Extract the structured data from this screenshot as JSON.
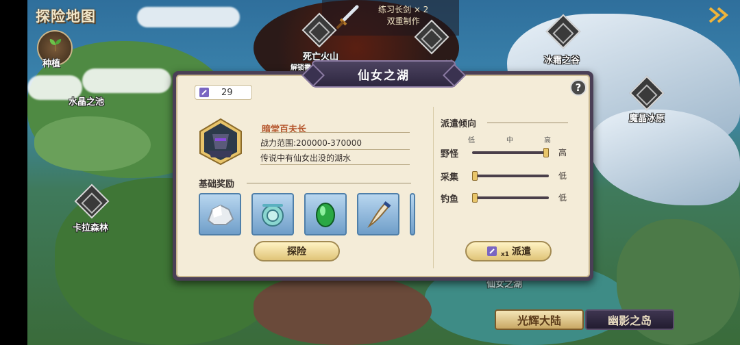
{
  "map": {
    "title": "探险地图",
    "plant_label": "种植",
    "locations": [
      {
        "name": "死亡火山"
      },
      {
        "name": "水晶之池"
      },
      {
        "name": "冰霜之谷"
      },
      {
        "name": "魔晶冰原"
      },
      {
        "name": "卡拉森林"
      }
    ],
    "obscured_labels": [
      "解锁需",
      "池",
      "仙女之湖"
    ],
    "quest": {
      "line1": "练习长剑 × 2",
      "line2": "双重制作"
    },
    "region_tabs": [
      {
        "label": "光辉大陆",
        "active": true
      },
      {
        "label": "幽影之岛",
        "active": false
      }
    ]
  },
  "dialog": {
    "title": "仙女之湖",
    "help_label": "?",
    "ticket_count": "29",
    "boss": {
      "name": "暗堂百夫长",
      "power_range": "战力范围:200000-370000",
      "description": "传说中有仙女出没的湖水"
    },
    "rewards_heading": "基础奖励",
    "rewards": [
      {
        "icon": "silver-ore-icon"
      },
      {
        "icon": "sea-scroll-icon"
      },
      {
        "icon": "emerald-gem-icon"
      },
      {
        "icon": "horn-tooth-icon"
      }
    ],
    "explore_button": "探险",
    "dispatch": {
      "heading": "派遣倾向",
      "levels": [
        "低",
        "中",
        "高"
      ],
      "sliders": [
        {
          "label": "野怪",
          "value_text": "高",
          "level": 1.0
        },
        {
          "label": "采集",
          "value_text": "低",
          "level": 0.0
        },
        {
          "label": "钓鱼",
          "value_text": "低",
          "level": 0.0
        }
      ],
      "button_label": "派遣",
      "cost_text": "x1"
    }
  },
  "colors": {
    "panel_frame": "#4a3f56",
    "panel_bg": "#f4ecd8",
    "accent_text": "#b4542a",
    "gold_button": "#e0c478"
  }
}
